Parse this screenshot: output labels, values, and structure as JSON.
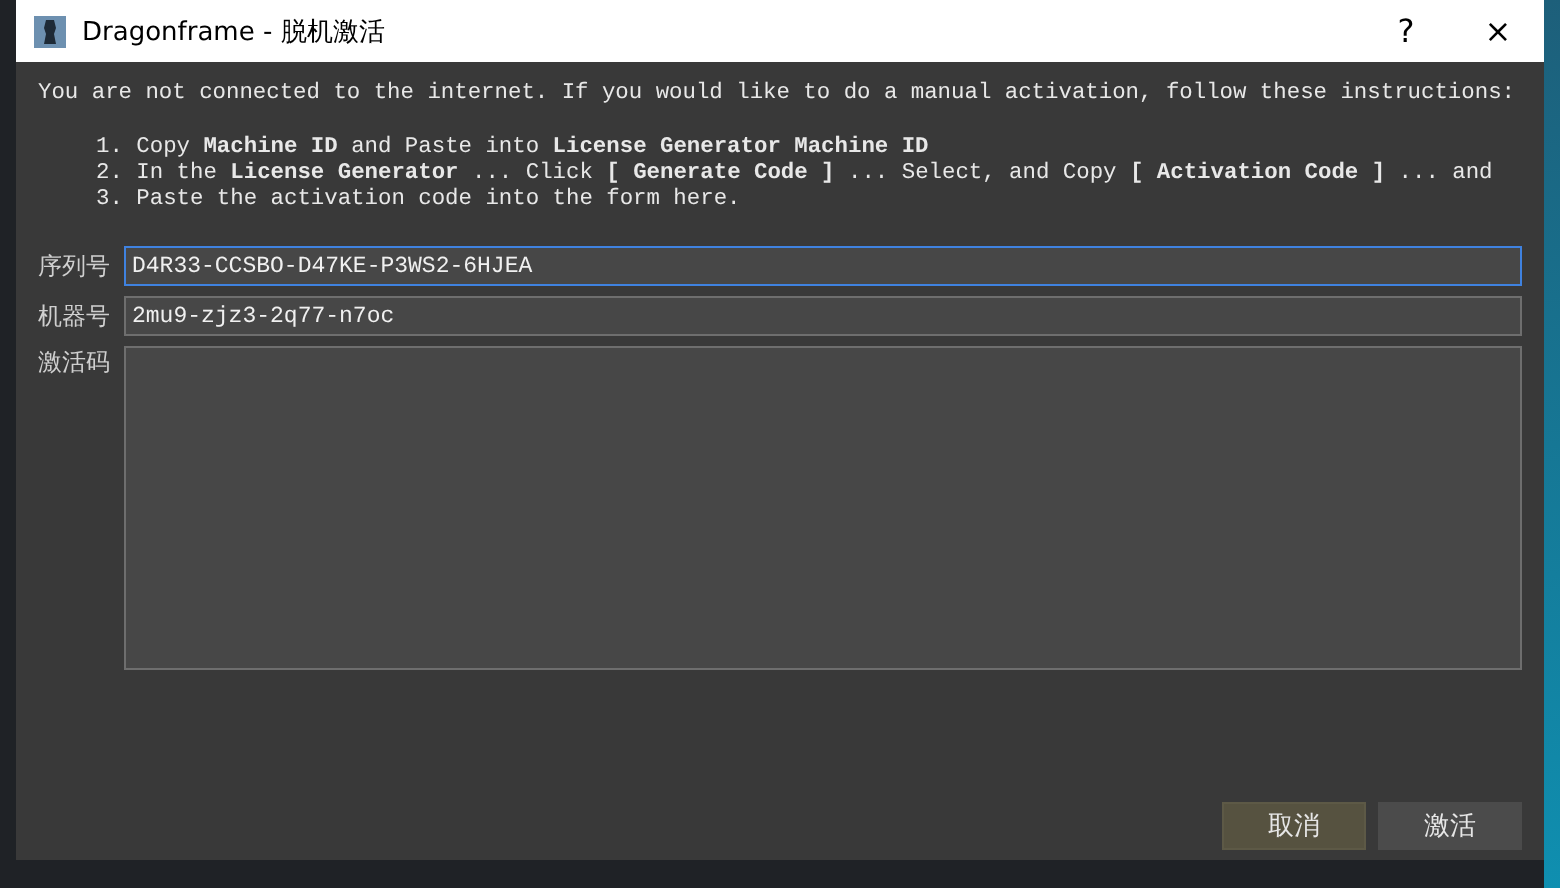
{
  "window": {
    "title": "Dragonframe - 脱机激活",
    "buttons": [
      "?",
      "×"
    ]
  },
  "intro": "You are not connected to the internet. If you would like to do a manual activation, follow these instructions:",
  "steps": [
    "1. Copy **Machine ID** and Paste into **License Generator Machine ID**",
    "2. In the **License Generator** ... Click **[ Generate Code ]** ... Select, and Copy **[ Activation Code ]** ... and",
    "3. Paste the activation code into the form here."
  ],
  "fields": [
    {
      "label": "序列号",
      "kind": "line",
      "value": "D4R33-CCSBO-D47KE-P3WS2-6HJEA",
      "focused": true
    },
    {
      "label": "机器号",
      "kind": "line",
      "value": "2mu9-zjz3-2q77-n7oc",
      "focused": false
    },
    {
      "label": "激活码",
      "kind": "area",
      "focused": false
    }
  ],
  "actions": [
    {
      "label": "取消",
      "highlighted": true
    },
    {
      "label": "激活",
      "highlighted": false
    }
  ]
}
